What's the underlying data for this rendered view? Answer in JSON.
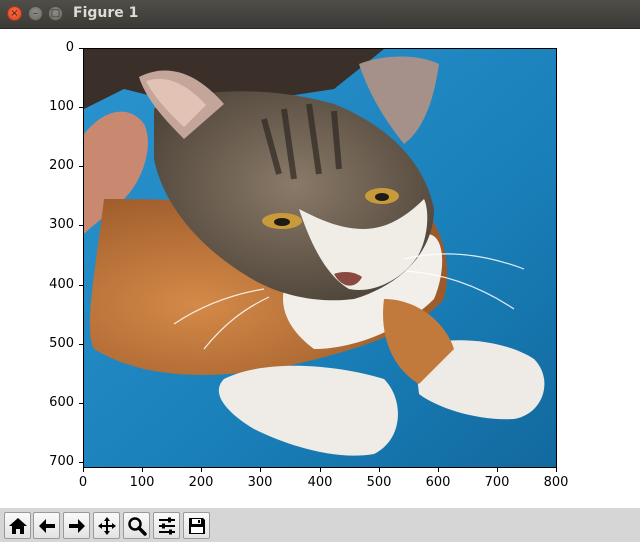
{
  "window": {
    "title": "Figure 1",
    "buttons": {
      "close_glyph": "×",
      "minimize_glyph": "–",
      "maximize_glyph": "□"
    }
  },
  "axes": {
    "y_ticks": [
      "0",
      "100",
      "200",
      "300",
      "400",
      "500",
      "600",
      "700"
    ],
    "x_ticks": [
      "0",
      "100",
      "200",
      "300",
      "400",
      "500",
      "600",
      "700",
      "800"
    ],
    "xlim": [
      0,
      800
    ],
    "ylim": [
      710,
      0
    ]
  },
  "image": {
    "subject": "calico-cat-on-blue-blanket"
  },
  "toolbar": {
    "buttons": [
      "home-icon",
      "back-arrow-icon",
      "forward-arrow-icon",
      "pan-move-icon",
      "zoom-magnifier-icon",
      "subplots-sliders-icon",
      "save-floppy-icon"
    ]
  },
  "colors": {
    "titlebar": "#3c3b37",
    "toolbar": "#d6d6d6",
    "blanket": "#1d87c2"
  }
}
